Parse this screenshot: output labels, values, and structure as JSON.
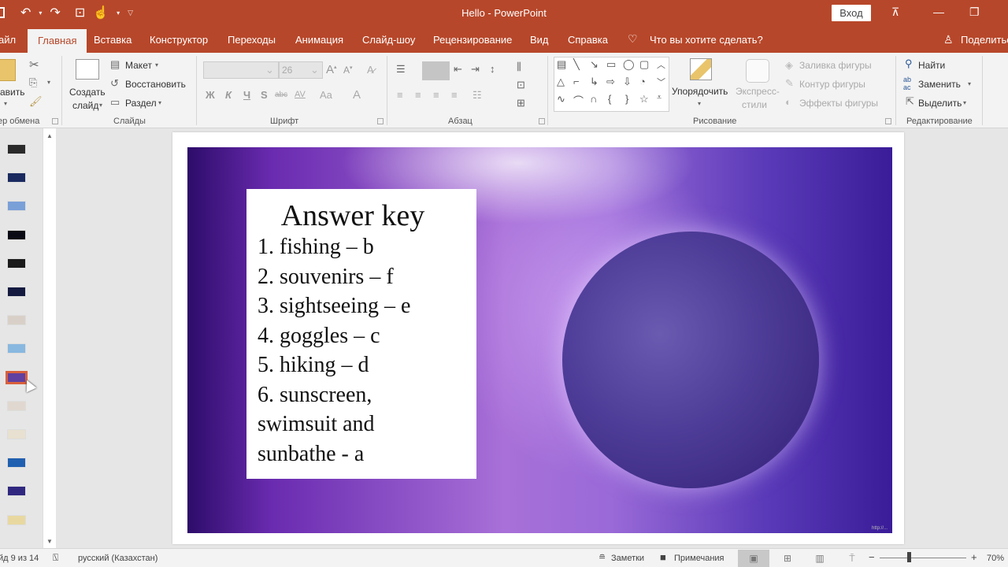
{
  "titlebar": {
    "title": "Hello  -  PowerPoint",
    "signin_label": "Вход",
    "qat_icons": [
      "save-icon",
      "undo-icon",
      "redo-icon",
      "present-from-start-icon",
      "touch-mode-icon",
      "customize-qat-icon"
    ]
  },
  "tabs": [
    {
      "label": "айл"
    },
    {
      "label": "Главная",
      "active": true
    },
    {
      "label": "Вставка"
    },
    {
      "label": "Конструктор"
    },
    {
      "label": "Переходы"
    },
    {
      "label": "Анимация"
    },
    {
      "label": "Слайд-шоу"
    },
    {
      "label": "Рецензирование"
    },
    {
      "label": "Вид"
    },
    {
      "label": "Справка"
    }
  ],
  "tell_me": "Что вы хотите сделать?",
  "share_label": "Поделиться",
  "ribbon": {
    "clipboard": {
      "paste_label": "авить",
      "group_label": "ер обмена"
    },
    "slides": {
      "new_slide_line1": "Создать",
      "new_slide_line2": "слайд",
      "layout_label": "Макет",
      "reset_label": "Восстановить",
      "section_label": "Раздел",
      "group_label": "Слайды"
    },
    "font": {
      "font_name": "",
      "font_size": "26",
      "bold": "Ж",
      "italic": "К",
      "underline": "Ч",
      "shadow": "S",
      "strike": "abc",
      "spacing": "AV",
      "case": "Aa",
      "color": "A",
      "group_label": "Шрифт"
    },
    "paragraph": {
      "group_label": "Абзац"
    },
    "drawing": {
      "arrange_label": "Упорядочить",
      "quick_styles_line1": "Экспресс-",
      "quick_styles_line2": "стили",
      "fill_label": "Заливка фигуры",
      "outline_label": "Контур фигуры",
      "effects_label": "Эффекты фигуры",
      "group_label": "Рисование"
    },
    "editing": {
      "find_label": "Найти",
      "replace_label": "Заменить",
      "select_label": "Выделить",
      "group_label": "Редактирование"
    }
  },
  "slides_panel": {
    "count": 14,
    "selected_index": 9,
    "thumb_colors": [
      "#2a2a2a",
      "#1a2a60",
      "#7aa0d8",
      "#0a0a14",
      "#1a1a1a",
      "#141a40",
      "#d8d0c8",
      "#88b8e0",
      "#6040a0",
      "#e0d8d0",
      "#e8e0d0",
      "#2060b0",
      "#302880",
      "#e8d8a0"
    ]
  },
  "slide": {
    "title": "Answer key",
    "lines": [
      "1. fishing – b",
      "2. souvenirs – f",
      "3. sightseeing – e",
      "4. goggles – c",
      "5. hiking – d",
      "6. sunscreen,",
      "swimsuit and",
      "sunbathe - a"
    ],
    "watermark": "http://..."
  },
  "statusbar": {
    "slide_indicator": "йд 9 из 14",
    "language": "русский (Казахстан)",
    "notes_label": "Заметки",
    "comments_label": "Примечания",
    "zoom_minus": "−",
    "zoom_plus": "+",
    "zoom_level": "70%",
    "zoom_percent": 70
  },
  "colors": {
    "accent": "#b7472a",
    "selection": "#d9603c"
  }
}
